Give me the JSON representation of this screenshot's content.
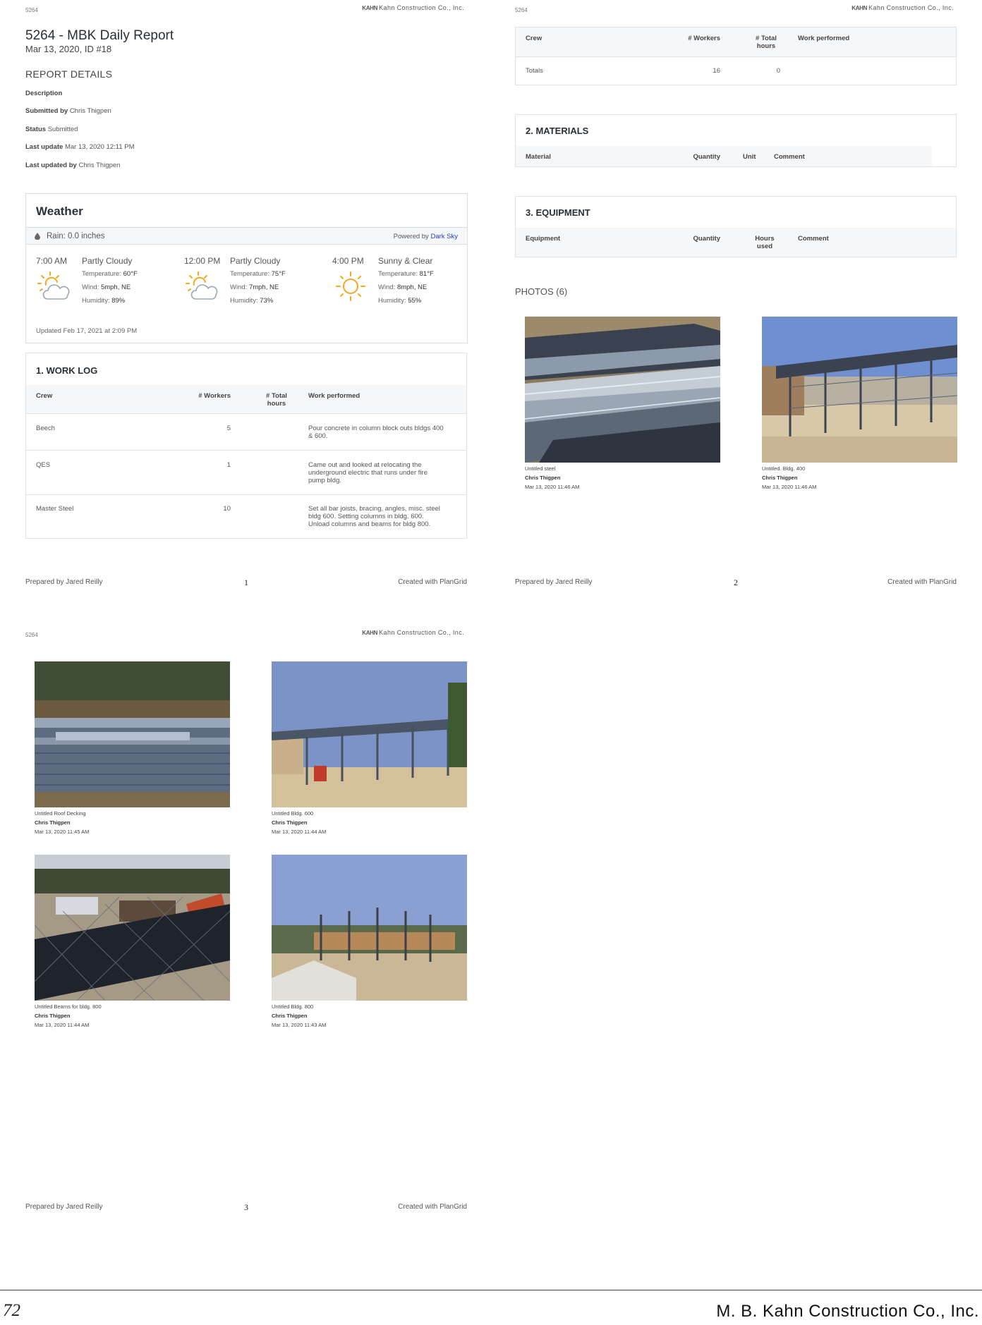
{
  "report": {
    "project_id": "5264",
    "company_logo": "Kahn Construction Co., Inc.",
    "company_logo_mark": "KAHN",
    "title": "5264 - MBK Daily Report",
    "subtitle": "Mar 13, 2020, ID #18",
    "details_heading": "REPORT DETAILS",
    "details": [
      {
        "label": "Description",
        "value": ""
      },
      {
        "label": "Submitted by",
        "value": "Chris Thigpen"
      },
      {
        "label": "Status",
        "value": "Submitted"
      },
      {
        "label": "Last update",
        "value": "Mar 13, 2020 12:11 PM"
      },
      {
        "label": "Last updated by",
        "value": "Chris Thigpen"
      }
    ]
  },
  "weather": {
    "title": "Weather",
    "rain": "Rain: 0.0 inches",
    "powered_prefix": "Powered by",
    "powered_link": "Dark Sky",
    "temp_label": "Temperature:",
    "wind_label": "Wind:",
    "humidity_label": "Humidity:",
    "slots": [
      {
        "time": "7:00 AM",
        "condition": "Partly Cloudy",
        "icon": "partly-cloudy-icon",
        "temperature": "60°F",
        "wind": "5mph, NE",
        "humidity": "89%"
      },
      {
        "time": "12:00 PM",
        "condition": "Partly Cloudy",
        "icon": "partly-cloudy-icon",
        "temperature": "75°F",
        "wind": "7mph, NE",
        "humidity": "73%"
      },
      {
        "time": "4:00 PM",
        "condition": "Sunny & Clear",
        "icon": "sun-icon",
        "temperature": "81°F",
        "wind": "8mph, NE",
        "humidity": "55%"
      }
    ],
    "updated": "Updated Feb 17, 2021 at 2:09 PM",
    "icon_color": "#f5a623"
  },
  "work_log": {
    "title": "1. WORK LOG",
    "headers": {
      "crew": "Crew",
      "workers": "# Workers",
      "hours_1": "# Total",
      "hours_2": "hours",
      "work": "Work performed"
    },
    "rows": [
      {
        "crew": "Beech",
        "workers": "5",
        "hours": "",
        "work_lines": [
          "Pour concrete in column block outs bldgs 400",
          "& 600."
        ]
      },
      {
        "crew": "QES",
        "workers": "1",
        "hours": "",
        "work_lines": [
          "Came out and looked at relocating the",
          "underground electric that runs under fire",
          "pump bldg."
        ]
      },
      {
        "crew": "Master Steel",
        "workers": "10",
        "hours": "",
        "work_lines": [
          "Set all bar joists, bracing, angles, misc. steel",
          "bldg 600. Setting columns in bldg. 600.",
          "Unload columns and beams for bldg 800."
        ]
      }
    ],
    "totals": {
      "label": "Totals",
      "workers": "16",
      "hours": "0"
    }
  },
  "materials": {
    "title": "2. MATERIALS",
    "headers": {
      "material": "Material",
      "quantity": "Quantity",
      "unit": "Unit",
      "comment": "Comment"
    }
  },
  "equipment": {
    "title": "3. EQUIPMENT",
    "headers": {
      "equipment": "Equipment",
      "quantity": "Quantity",
      "hours_1": "Hours",
      "hours_2": "used",
      "comment": "Comment"
    }
  },
  "photos": {
    "heading": "PHOTOS (6)",
    "items": [
      {
        "caption": "Untitled steel",
        "author": "Chris Thigpen",
        "timestamp": "Mar 13, 2020 11:46 AM"
      },
      {
        "caption": "Untitled. Bldg. 400",
        "author": "Chris Thigpen",
        "timestamp": "Mar 13, 2020 11:46 AM"
      },
      {
        "caption": "Untitled Roof Decking",
        "author": "Chris Thigpen",
        "timestamp": "Mar 13, 2020 11:45 AM"
      },
      {
        "caption": "Untitled Bldg. 600",
        "author": "Chris Thigpen",
        "timestamp": "Mar 13, 2020 11:44 AM"
      },
      {
        "caption": "Untitled Beams for bldg. 800",
        "author": "Chris Thigpen",
        "timestamp": "Mar 13, 2020 11:44 AM"
      },
      {
        "caption": "Untitled Bldg. 800",
        "author": "Chris Thigpen",
        "timestamp": "Mar 13, 2020 11:43 AM"
      }
    ]
  },
  "footer": {
    "prepared": "Prepared by Jared Reilly",
    "created": "Created with PlanGrid",
    "pages": [
      "1",
      "2",
      "3"
    ]
  },
  "document_footer": {
    "page_number": "72",
    "company": "M. B. Kahn Construction Co., Inc."
  }
}
